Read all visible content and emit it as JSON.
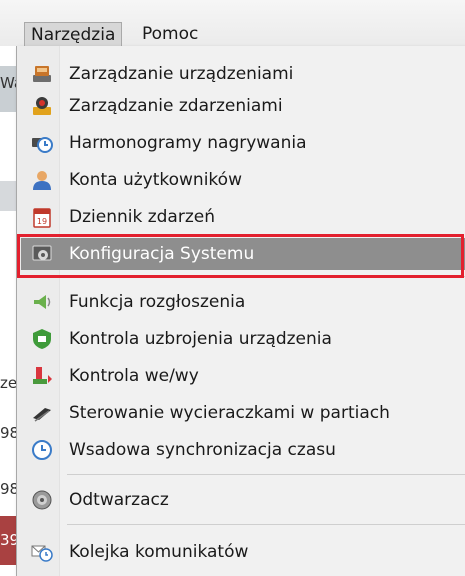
{
  "menubar": {
    "items": [
      {
        "label": "Narzędzia",
        "active": true
      },
      {
        "label": "Pomoc",
        "active": false
      }
    ]
  },
  "background_fragments": [
    "Wa",
    "ze",
    "98",
    "98",
    "39"
  ],
  "menu": {
    "items": [
      {
        "label": "Zarządzanie urządzeniami",
        "icon": "device-manager-icon"
      },
      {
        "label": "Zarządzanie zdarzeniami",
        "icon": "event-manager-icon"
      },
      {
        "label": "Harmonogramy nagrywania",
        "icon": "recording-schedule-icon"
      },
      {
        "label": "Konta użytkowników",
        "icon": "user-accounts-icon"
      },
      {
        "label": "Dziennik zdarzeń",
        "icon": "event-log-icon"
      },
      {
        "label": "Konfiguracja Systemu",
        "icon": "system-config-icon",
        "selected": true
      },
      {
        "label": "Funkcja rozgłoszenia",
        "icon": "broadcast-icon"
      },
      {
        "label": "Kontrola uzbrojenia urządzenia",
        "icon": "arming-control-icon"
      },
      {
        "label": "Kontrola we/wy",
        "icon": "io-control-icon"
      },
      {
        "label": "Sterowanie wycieraczkami w partiach",
        "icon": "wiper-control-icon"
      },
      {
        "label": "Wsadowa synchronizacja czasu",
        "icon": "time-sync-icon"
      },
      {
        "label": "Odtwarzacz",
        "icon": "player-icon"
      },
      {
        "label": "Kolejka komunikatów",
        "icon": "message-queue-icon"
      }
    ]
  },
  "colors": {
    "selected_bg": "#8e8e8e",
    "highlight_frame": "#e3202e",
    "menu_bg": "#f1f1f1"
  }
}
